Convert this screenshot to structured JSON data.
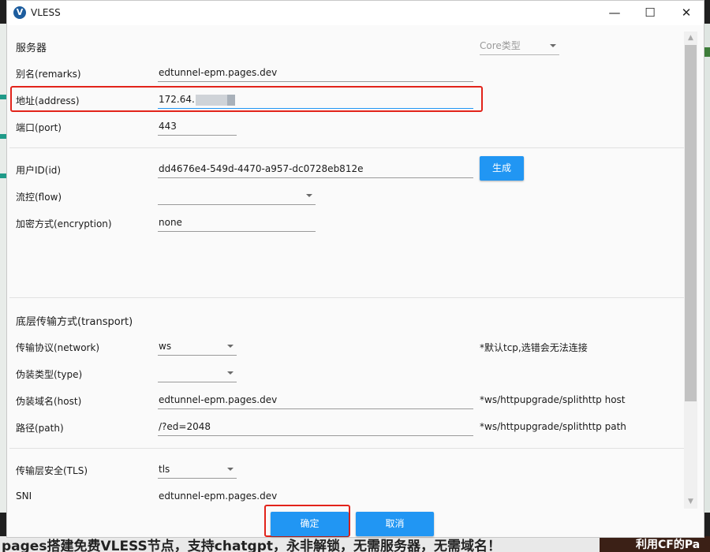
{
  "window": {
    "title": "VLESS",
    "logo_glyph": "V",
    "controls": {
      "minimize": "—",
      "maximize": "☐",
      "close": "✕"
    }
  },
  "background": {
    "bottom_text": "pages搭建免费VLESS节点，支持chatgpt，永非解锁，无需服务器，无需域名！",
    "bottom_right_text": "利用CF的Pa"
  },
  "server": {
    "section_label": "服务器",
    "core_type_placeholder": "Core类型",
    "remarks": {
      "label": "别名(remarks)",
      "value": "edtunnel-epm.pages.dev"
    },
    "address": {
      "label": "地址(address)",
      "value": "172.64."
    },
    "port": {
      "label": "端口(port)",
      "value": "443"
    }
  },
  "user": {
    "id": {
      "label": "用户ID(id)",
      "value": "dd4676e4-549d-4470-a957-dc0728eb812e"
    },
    "generate_button": "生成",
    "flow": {
      "label": "流控(flow)",
      "value": ""
    },
    "encryption": {
      "label": "加密方式(encryption)",
      "value": "none"
    }
  },
  "transport": {
    "section_label": "底层传输方式(transport)",
    "network": {
      "label": "传输协议(network)",
      "value": "ws",
      "hint": "*默认tcp,选错会无法连接"
    },
    "type": {
      "label": "伪装类型(type)",
      "value": ""
    },
    "host": {
      "label": "伪装域名(host)",
      "value": "edtunnel-epm.pages.dev",
      "hint": "*ws/httpupgrade/splithttp host"
    },
    "path": {
      "label": "路径(path)",
      "value": "/?ed=2048",
      "hint": "*ws/httpupgrade/splithttp path"
    }
  },
  "tls": {
    "security": {
      "label": "传输层安全(TLS)",
      "value": "tls"
    },
    "sni": {
      "label": "SNI",
      "value": "edtunnel-epm.pages.dev"
    }
  },
  "buttons": {
    "confirm": "确定",
    "cancel": "取消"
  },
  "colors": {
    "accent": "#2196f3",
    "highlight": "#e2231a"
  },
  "scrollbar": {
    "up_glyph": "▲",
    "down_glyph": "▼"
  }
}
